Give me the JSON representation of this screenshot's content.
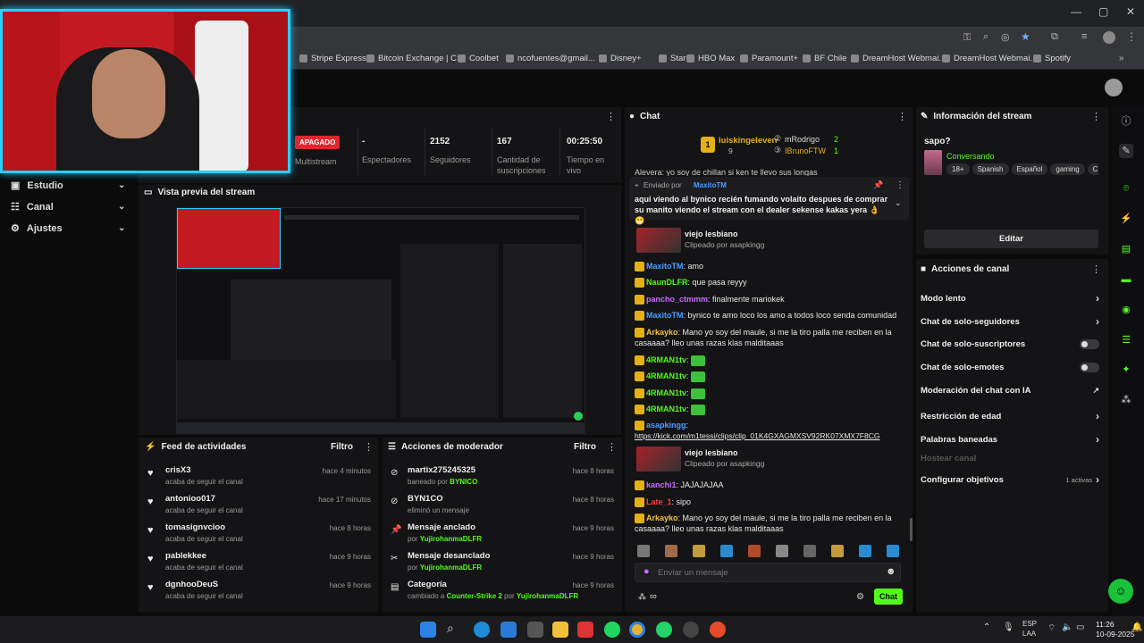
{
  "bookmarks": [
    "Stripe Express",
    "Bitcoin Exchange | C...",
    "Coolbet",
    "ncofuentes@gmail...",
    "Disney+",
    "Star+",
    "HBO Max",
    "Paramount+",
    "BF Chile",
    "DreamHost Webmai...",
    "DreamHost Webmai...",
    "Spotify"
  ],
  "stream_status": {
    "badge": "APAGADO",
    "multistream": "Multistream",
    "viewers_value": "-",
    "viewers_label": "Espectadores",
    "followers_value": "2152",
    "followers_label": "Seguidores",
    "subs_value": "167",
    "subs_label": "Cantidad de suscripciones",
    "time_value": "00:25:50",
    "time_label": "Tiempo en vivo"
  },
  "sidebar": {
    "items": [
      {
        "label": "Estudio"
      },
      {
        "label": "Canal"
      },
      {
        "label": "Ajustes"
      }
    ]
  },
  "preview": {
    "title": "Vista previa del stream"
  },
  "activity_feed": {
    "title": "Feed de actividades",
    "filter": "Filtro",
    "items": [
      {
        "name": "crisX3",
        "desc": "acaba de seguir el canal",
        "time": "hace 4 minutos"
      },
      {
        "name": "antonioo017",
        "desc": "acaba de seguir el canal",
        "time": "hace 17 minutos"
      },
      {
        "name": "tomasignvcioo",
        "desc": "acaba de seguir el canal",
        "time": "hace 8 horas"
      },
      {
        "name": "pablekkee",
        "desc": "acaba de seguir el canal",
        "time": "hace 9 horas"
      },
      {
        "name": "dgnhooDeuS",
        "desc": "acaba de seguir el canal",
        "time": "hace 9 horas"
      }
    ]
  },
  "mod_actions": {
    "title": "Acciones de moderador",
    "filter": "Filtro",
    "items": [
      {
        "name": "martix275245325",
        "desc_prefix": "baneado por",
        "desc_user": "BYNICO",
        "time": "hace 8 horas"
      },
      {
        "name": "BYN1CO",
        "desc_prefix": "eliminó un mensaje",
        "desc_user": "",
        "time": "hace 8 horas"
      },
      {
        "name": "Mensaje anclado",
        "desc_prefix": "por",
        "desc_user": "YujirohanmaDLFR",
        "time": "hace 9 horas"
      },
      {
        "name": "Mensaje desanclado",
        "desc_prefix": "por",
        "desc_user": "YujirohanmaDLFR",
        "time": "hace 9 horas"
      },
      {
        "name": "Categoría",
        "desc_prefix": "cambiado a",
        "desc_user": "Counter-Strike 2",
        "desc_suffix": "por",
        "desc_user2": "YujirohanmaDLFR",
        "time": "hace 9 horas"
      }
    ]
  },
  "chat": {
    "title": "Chat",
    "leaderboard": {
      "first": "luiskingeleven",
      "first_count": "9",
      "second": "mRodrigo",
      "second_count": "2",
      "third": "IBrunoFTW",
      "third_count": "1"
    },
    "top_partial": "Alevera: yo soy de chillan si ken te llevo sus longas",
    "pinned": {
      "by_label": "Enviado por",
      "by_user": "MaxitoTM",
      "text": "aqui viendo al bynico recién fumando volaito despues de comprar su manito viendo el stream con el dealer sekense kakas yera 👌 😁"
    },
    "messages": [
      {
        "type": "clip",
        "title": "viejo lesbiano",
        "sub": "Clipeado por asapkingg"
      },
      {
        "type": "msg",
        "user": "MaxitoTM",
        "text": "amo",
        "color": "#4f9dff"
      },
      {
        "type": "msg",
        "user": "NaunDLFR",
        "text": "que pasa reyyy",
        "color": "#53fc18"
      },
      {
        "type": "msg",
        "user": "pancho_ctmmm",
        "text": "finalmente mariokek",
        "color": "#c86cff"
      },
      {
        "type": "msg",
        "user": "MaxitoTM",
        "text": "bynico te amo loco los amo a todos loco senda comunidad",
        "color": "#4f9dff"
      },
      {
        "type": "msg",
        "user": "Arkayko",
        "text": "Mano yo soy del maule, si me la tiro palla me reciben en la casaaaa? lleo unas razas klas malditaaas",
        "color": "#f0c24a"
      },
      {
        "type": "msg",
        "user": "4RMAN1tv",
        "text": "",
        "color": "#53fc18"
      },
      {
        "type": "msg",
        "user": "4RMAN1tv",
        "text": "",
        "color": "#53fc18"
      },
      {
        "type": "msg",
        "user": "4RMAN1tv",
        "text": "",
        "color": "#53fc18"
      },
      {
        "type": "msg",
        "user": "4RMAN1tv",
        "text": "",
        "color": "#53fc18"
      },
      {
        "type": "link",
        "user": "asapkingg",
        "text": "https://kick.com/m1tessi/clips/clip_01K4GXAGMXSV92RK07XMX7F8CG",
        "color": "#4f9dff"
      },
      {
        "type": "clip",
        "title": "viejo lesbiano",
        "sub": "Clipeado por asapkingg"
      },
      {
        "type": "msg",
        "user": "kanchi1",
        "text": "JAJAJAJAA",
        "color": "#c86cff"
      },
      {
        "type": "msg",
        "user": "Late_1",
        "text": "sipo",
        "color": "#ff3b3b"
      },
      {
        "type": "msg",
        "user": "Arkayko",
        "text": "Mano yo soy del maule, si me la tiro palla me reciben en la casaaaa? lleo unas razas klas malditaaas",
        "color": "#f0c24a"
      }
    ],
    "input_placeholder": "Enviar un mensaje",
    "send_label": "Chat"
  },
  "stream_info": {
    "title": "Información del stream",
    "stream_title": "sapo?",
    "category": "Conversando",
    "tags": [
      "18+",
      "Spanish",
      "Español",
      "gaming",
      "Chile"
    ],
    "edit_label": "Editar"
  },
  "channel_actions": {
    "title": "Acciones de canal",
    "items": [
      {
        "label": "Modo lento",
        "control": "chevron"
      },
      {
        "label": "Chat de solo-seguidores",
        "control": "chevron"
      },
      {
        "label": "Chat de solo-suscriptores",
        "control": "toggle"
      },
      {
        "label": "Chat de solo-emotes",
        "control": "toggle"
      },
      {
        "label": "Moderación del chat con IA",
        "control": "external"
      },
      {
        "label": "Restricción de edad",
        "control": "chevron"
      },
      {
        "label": "Palabras baneadas",
        "control": "chevron"
      },
      {
        "label": "Hostear canal",
        "control": "none"
      },
      {
        "label": "Configurar objetivos",
        "control": "chevron",
        "extra": "1 activas"
      }
    ]
  },
  "taskbar": {
    "lang": "ESP",
    "lang2": "LAA",
    "time": "11:26",
    "date": "10-09-2025"
  },
  "colors": {
    "accent": "#53fc18",
    "webcam_border": "#28d0ff",
    "badge_off": "#e0262f"
  }
}
